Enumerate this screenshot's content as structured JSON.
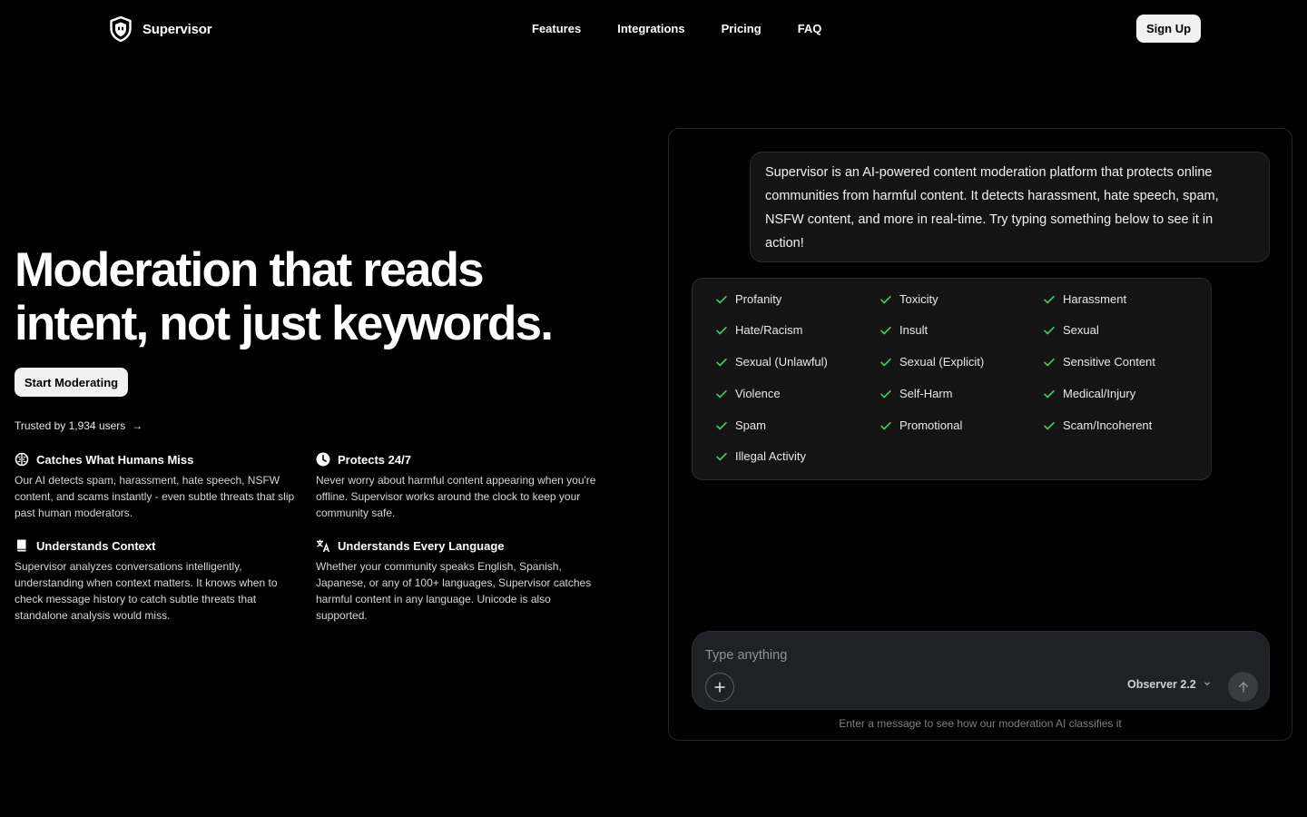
{
  "header": {
    "brand": "Supervisor",
    "brand_icon": "shield-icon",
    "nav": [
      "Features",
      "Integrations",
      "Pricing",
      "FAQ"
    ],
    "signup_label": "Sign Up"
  },
  "hero": {
    "title_line1": "Moderation that reads",
    "title_line2": "intent, not just keywords.",
    "cta_label": "Start Moderating",
    "trusted_text": "Trusted by 1,934 users",
    "trusted_arrow": "→"
  },
  "features": [
    {
      "icon": "brain-icon",
      "title": "Catches What Humans Miss",
      "description": "Our AI detects spam, harassment, hate speech, NSFW content, and scams instantly - even subtle threats that slip past human moderators."
    },
    {
      "icon": "clock-icon",
      "title": "Protects 24/7",
      "description": "Never worry about harmful content appearing when you're offline. Supervisor works around the clock to keep your community safe."
    },
    {
      "icon": "book-icon",
      "title": "Understands Context",
      "description": "Supervisor analyzes conversations intelligently, understanding when context matters. It knows when to check message history to catch subtle threats that standalone analysis would miss."
    },
    {
      "icon": "translate-icon",
      "title": "Understands Every Language",
      "description": "Whether your community speaks English, Spanish, Japanese, or any of 100+ languages, Supervisor catches harmful content in any language. Unicode is also supported."
    }
  ],
  "demo": {
    "intro_message": "Supervisor is an AI-powered content moderation platform that protects online communities from harmful content. It detects harassment, hate speech, spam, NSFW content, and more in real-time. Try typing something below to see it in action!",
    "categories": [
      "Profanity",
      "Toxicity",
      "Harassment",
      "Hate/Racism",
      "Insult",
      "Sexual",
      "Sexual (Unlawful)",
      "Sexual (Explicit)",
      "Sensitive Content",
      "Violence",
      "Self-Harm",
      "Medical/Injury",
      "Spam",
      "Promotional",
      "Scam/Incoherent",
      "Illegal Activity"
    ],
    "check_color": "#3ecf6e",
    "input_placeholder": "Type anything",
    "model_label": "Observer 2.2",
    "hint": "Enter a message to see how our moderation AI classifies it"
  }
}
